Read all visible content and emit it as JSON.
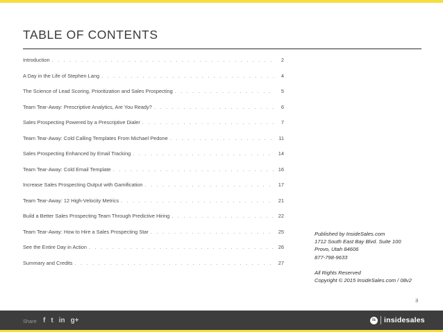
{
  "title": "TABLE OF CONTENTS",
  "toc": [
    {
      "title": "Introduction",
      "page": "2"
    },
    {
      "title": "A Day in the Life of Stephen Lang",
      "page": "4"
    },
    {
      "title": "The Science of Lead Scoring, Prioritization and Sales Prospecting",
      "page": "5"
    },
    {
      "title": "Team Tear-Away: Prescriptive Analytics, Are You Ready?",
      "page": "6"
    },
    {
      "title": "Sales Prospecting Powered by a Prescriptive Dialer",
      "page": "7"
    },
    {
      "title": "Team Tear-Away: Cold Calling Templates From Michael Pedone",
      "page": "11"
    },
    {
      "title": "Sales Prospecting Enhanced by Email Tracking",
      "page": "14"
    },
    {
      "title": "Team Tear-Away: Cold Email Template",
      "page": "16"
    },
    {
      "title": "Increase Sales Prospecting Output with Gamification",
      "page": "17"
    },
    {
      "title": "Team Tear-Away: 12 High-Velocity Metrics",
      "page": "21"
    },
    {
      "title": "Build a Better Sales Prospecting Team Through Predictive Hiring",
      "page": "22"
    },
    {
      "title": "Team Tear-Away: How to Hire a Sales Prospecting Star",
      "page": "25"
    },
    {
      "title": "See the Entire Day in Action",
      "page": "26"
    },
    {
      "title": "Summary and Credits",
      "page": "27"
    }
  ],
  "publisher": {
    "published_by": "Published by InsideSales.com",
    "address_line1": "1712 South East Bay Blvd. Suite 100",
    "address_line2": "Provo, Utah 84606",
    "phone": "877-798-9633",
    "rights": "All Rights Reserved",
    "copyright": "Copyright © 2015 InsideSales.com / 08v2"
  },
  "page_number": "3",
  "footer": {
    "share_label": "Share",
    "social": [
      "f",
      "t",
      "in",
      "g+"
    ],
    "social_icons": [
      "facebook-icon",
      "twitter-icon",
      "linkedin-icon",
      "google-plus-icon"
    ],
    "brand_mark": "is",
    "brand": "insidesales"
  },
  "colors": {
    "accent": "#f5dd3b",
    "footer_bg": "#3d3d3d",
    "text": "#2b2b2b"
  }
}
